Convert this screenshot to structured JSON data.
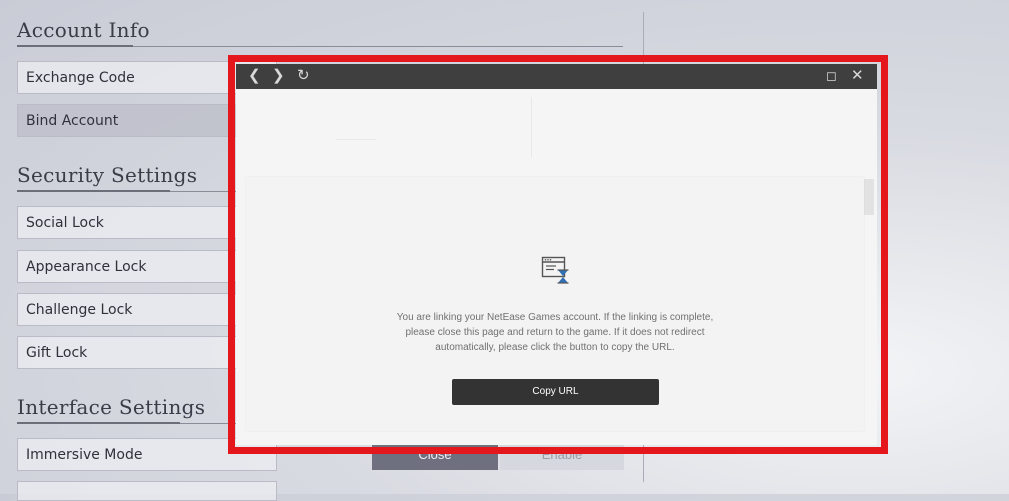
{
  "sections": {
    "account_info": "Account Info",
    "security_settings": "Security Settings",
    "interface_settings": "Interface Settings"
  },
  "rows": {
    "exchange_code": "Exchange Code",
    "bind_account": "Bind Account",
    "social_lock": "Social Lock",
    "appearance_lock": "Appearance Lock",
    "challenge_lock": "Challenge Lock",
    "gift_lock": "Gift Lock",
    "immersive_mode": "Immersive Mode"
  },
  "immersive_mode_buttons": {
    "close": "Close",
    "enable": "Enable"
  },
  "browser": {
    "icons": [
      "back-icon",
      "forward-icon",
      "refresh-icon",
      "maximize-icon",
      "close-icon"
    ],
    "message": "You are linking your NetEase Games account. If the linking is complete, please close this page and return to the game. If it does not redirect automatically, please click the button to copy the URL.",
    "copy_button": "Copy URL"
  },
  "colors": {
    "highlight_frame": "#e3171c",
    "browser_bar": "#3f3f3f",
    "copy_button": "#333333"
  }
}
